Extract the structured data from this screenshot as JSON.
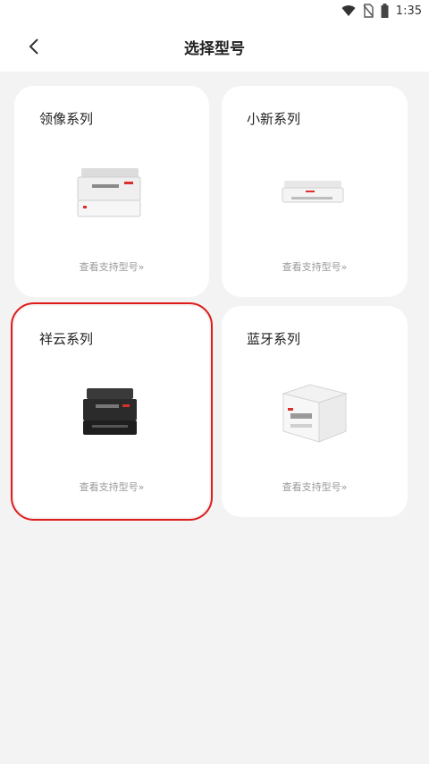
{
  "status_bar": {
    "time": "1:35"
  },
  "header": {
    "title": "选择型号"
  },
  "series": [
    {
      "name": "领像系列",
      "link": "查看支持型号»",
      "icon": "multifunction-printer-icon"
    },
    {
      "name": "小新系列",
      "link": "查看支持型号»",
      "icon": "compact-printer-icon"
    },
    {
      "name": "祥云系列",
      "link": "查看支持型号»",
      "icon": "black-laser-printer-icon"
    },
    {
      "name": "蓝牙系列",
      "link": "查看支持型号»",
      "icon": "white-mfp-printer-icon"
    }
  ],
  "colors": {
    "accent": "#d9302b",
    "selection": "#e01b1b"
  }
}
